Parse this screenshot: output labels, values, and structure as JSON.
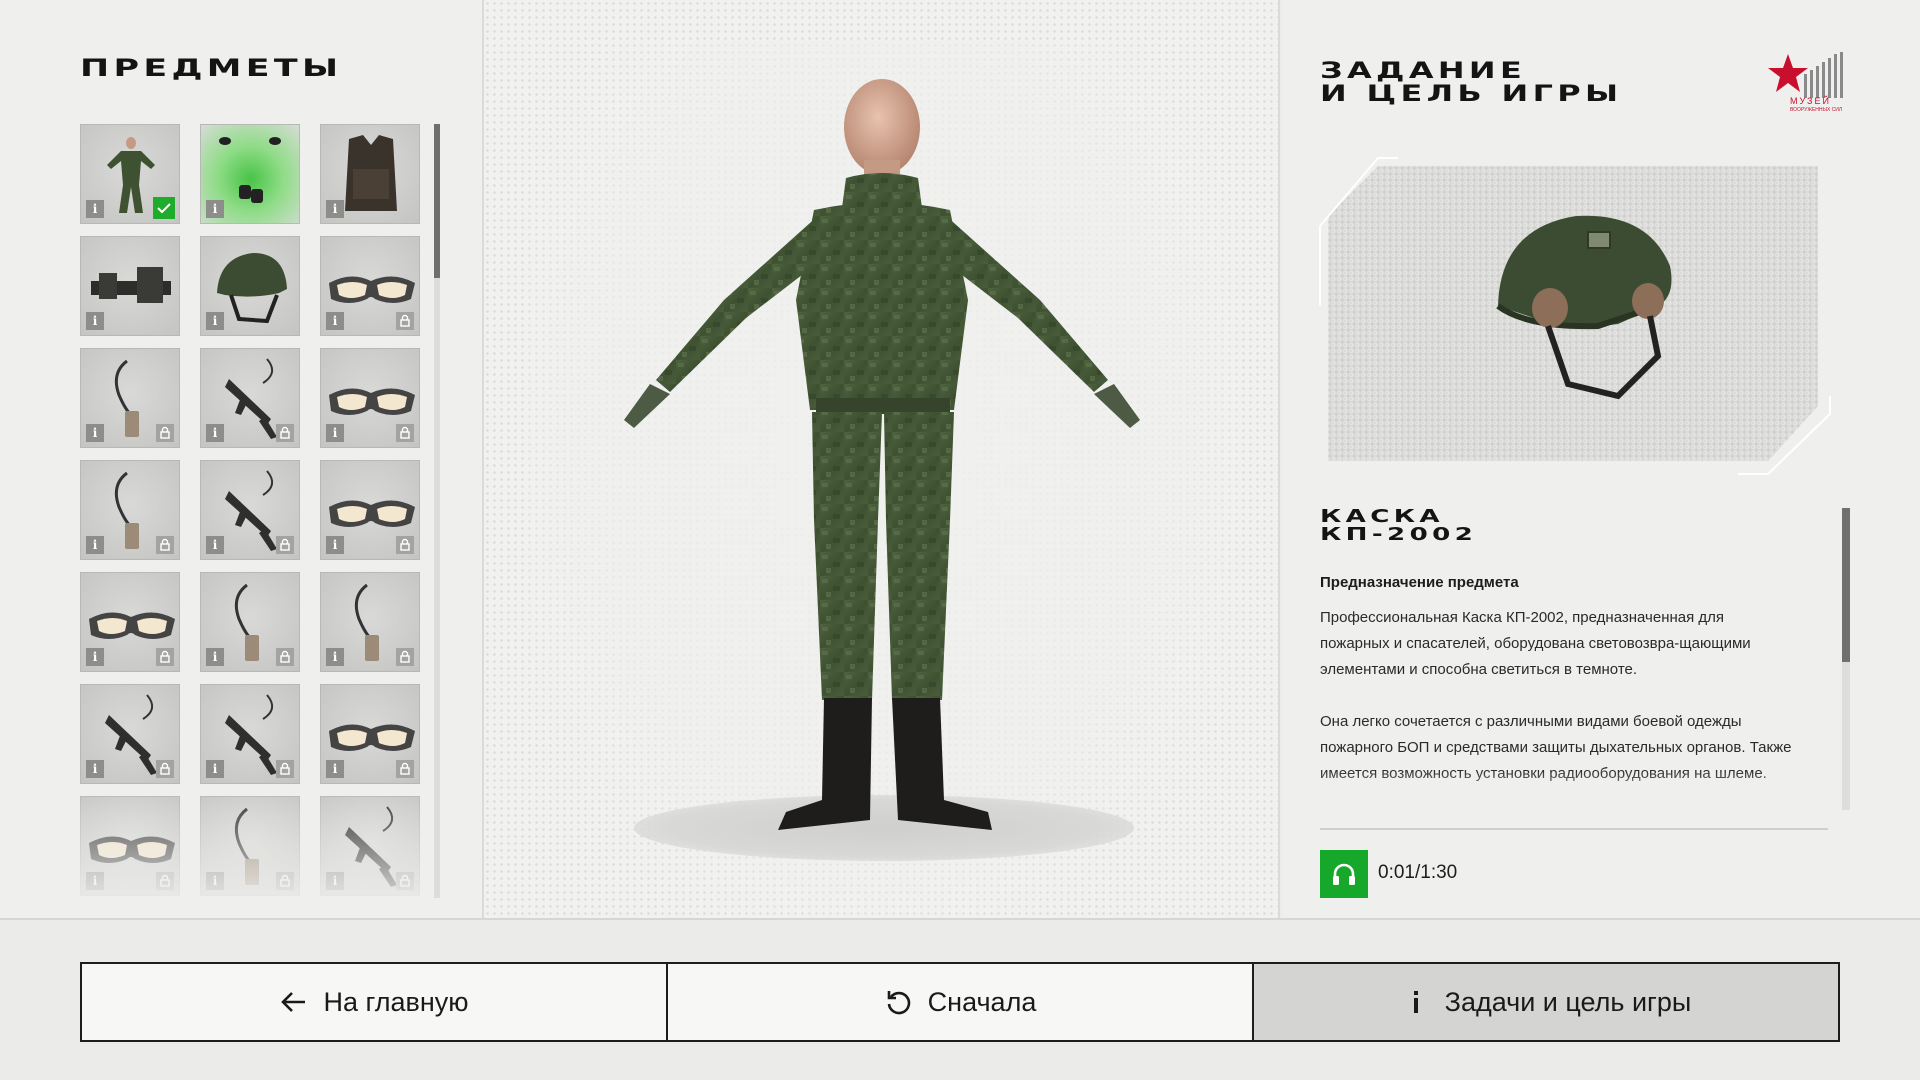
{
  "left_panel": {
    "title": "ПРЕДМЕТЫ",
    "items": [
      {
        "kind": "uniform",
        "state": "selected"
      },
      {
        "kind": "gloves",
        "state": "active"
      },
      {
        "kind": "vest",
        "state": "available"
      },
      {
        "kind": "belt-kit",
        "state": "available"
      },
      {
        "kind": "helmet",
        "state": "available"
      },
      {
        "kind": "goggles",
        "state": "locked"
      },
      {
        "kind": "radio",
        "state": "locked"
      },
      {
        "kind": "rifle",
        "state": "locked"
      },
      {
        "kind": "goggles",
        "state": "locked"
      },
      {
        "kind": "radio",
        "state": "locked"
      },
      {
        "kind": "rifle",
        "state": "locked"
      },
      {
        "kind": "goggles",
        "state": "locked"
      },
      {
        "kind": "goggles",
        "state": "locked"
      },
      {
        "kind": "radio",
        "state": "locked"
      },
      {
        "kind": "radio",
        "state": "locked"
      },
      {
        "kind": "rifle",
        "state": "locked"
      },
      {
        "kind": "rifle",
        "state": "locked"
      },
      {
        "kind": "goggles",
        "state": "locked"
      },
      {
        "kind": "goggles",
        "state": "locked"
      },
      {
        "kind": "radio",
        "state": "locked"
      },
      {
        "kind": "rifle",
        "state": "locked"
      }
    ],
    "info_label": "i"
  },
  "right_panel": {
    "title_line1": "ЗАДАНИЕ",
    "title_line2": "И ЦЕЛЬ ИГРЫ",
    "logo_text": "МУЗЕЙ",
    "logo_subtext": "ВООРУЖЕННЫХ СИЛ",
    "item_name_line1": "КАСКА",
    "item_name_line2": "КП-2002",
    "desc_heading": "Предназначение предмета",
    "desc_para1": "Профессиональная Каска КП-2002, предназначенная для пожарных и спасателей, оборудована световозвра-щающими элементами и способна светиться в темноте.",
    "desc_para2": "Она легко сочетается с различными видами боевой одежды пожарного БОП и средствами защиты дыхательных органов. Также имеется возможность установки радиооборудования на шлеме.",
    "audio_time": "0:01/1:30"
  },
  "bottom_nav": {
    "home_label": "На главную",
    "restart_label": "Сначала",
    "tasks_label": "Задачи и цель игры"
  },
  "colors": {
    "accent_green": "#16a82a",
    "logo_red": "#c8102e"
  }
}
